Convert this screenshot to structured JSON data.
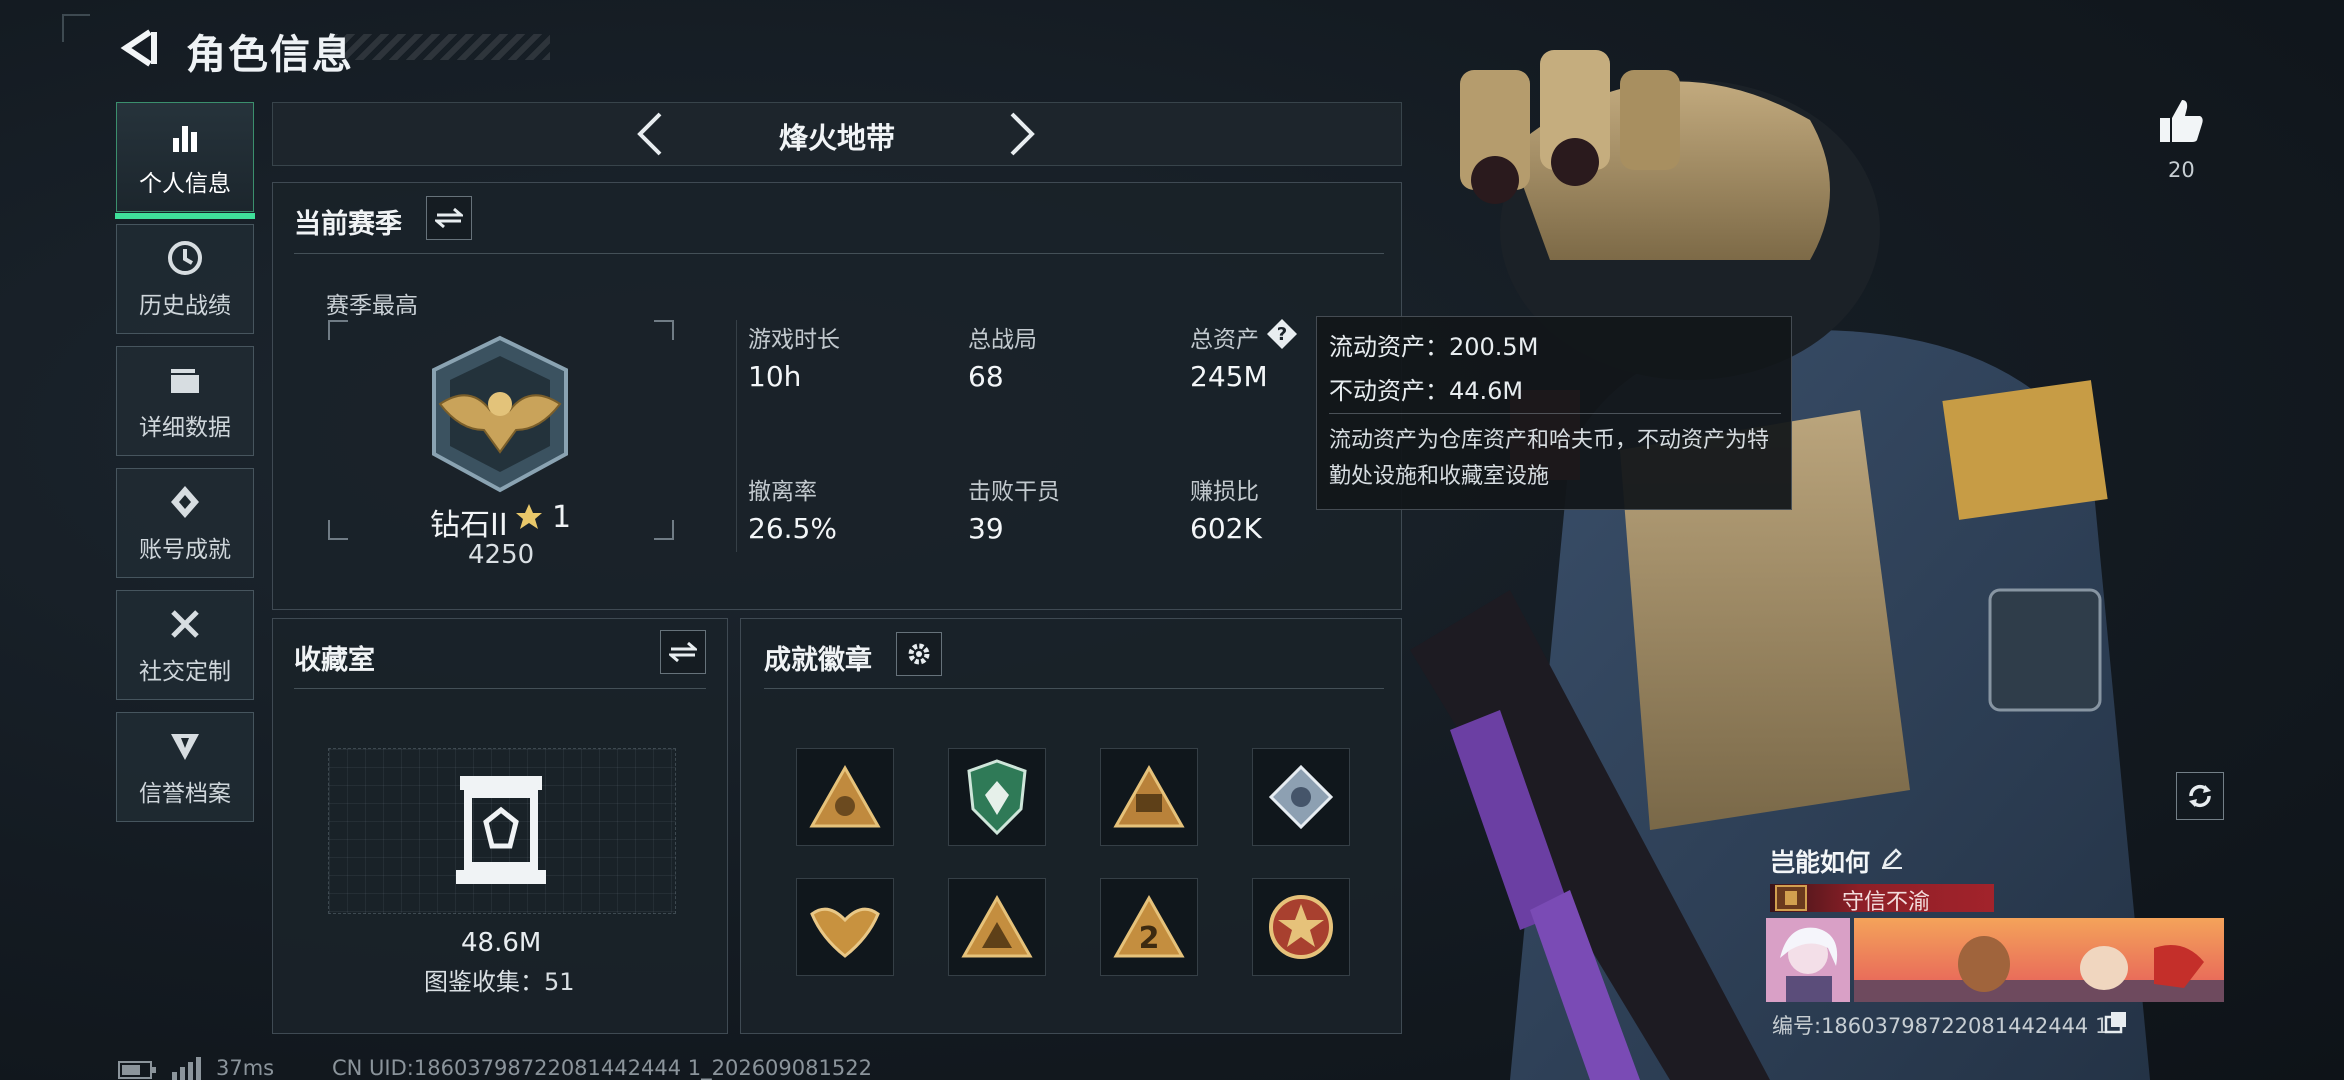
{
  "header": {
    "title": "角色信息",
    "back": "back-arrow-icon"
  },
  "sidebar": {
    "items": [
      {
        "label": "个人信息",
        "icon": "bar-chart-icon",
        "active": true
      },
      {
        "label": "历史战绩",
        "icon": "clock-icon",
        "active": false
      },
      {
        "label": "详细数据",
        "icon": "folder-icon",
        "active": false
      },
      {
        "label": "账号成就",
        "icon": "achievement-icon",
        "active": false
      },
      {
        "label": "社交定制",
        "icon": "tools-icon",
        "active": false
      },
      {
        "label": "信誉档案",
        "icon": "credit-icon",
        "active": false
      }
    ]
  },
  "mode": {
    "title": "烽火地带"
  },
  "season": {
    "title": "当前赛季",
    "best_label": "赛季最高",
    "rank_name": "钻石II",
    "rank_stars": "1",
    "rank_score": "4250",
    "stats": [
      {
        "label": "游戏时长",
        "value": "10h"
      },
      {
        "label": "总战局",
        "value": "68"
      },
      {
        "label": "总资产",
        "value": "245M"
      },
      {
        "label": "撤离率",
        "value": "26.5%"
      },
      {
        "label": "击败干员",
        "value": "39"
      },
      {
        "label": "赚损比",
        "value": "602K"
      }
    ]
  },
  "tooltip": {
    "liquid": "流动资产：200.5M",
    "fixed": "不动资产：44.6M",
    "desc": "流动资产为仓库资产和哈夫币，不动资产为特勤处设施和收藏室设施"
  },
  "collection": {
    "title": "收藏室",
    "value": "48.6M",
    "codex": "图鉴收集：51"
  },
  "badges": {
    "title": "成就徽章",
    "items": [
      "badge-1",
      "badge-2",
      "badge-3",
      "badge-4",
      "badge-5",
      "badge-6",
      "badge-7",
      "badge-8"
    ]
  },
  "likes": {
    "count": "20"
  },
  "card": {
    "name": "岂能如何",
    "title": "守信不渝",
    "id_text": "编号:18603798722081442444 1"
  },
  "footer": {
    "ping": "37ms",
    "uid": "CN UID:18603798722081442444 1_202609081522"
  },
  "colors": {
    "accent": "#3fe09a",
    "title_red": "#a2232b",
    "gold": "#c9a35a"
  }
}
